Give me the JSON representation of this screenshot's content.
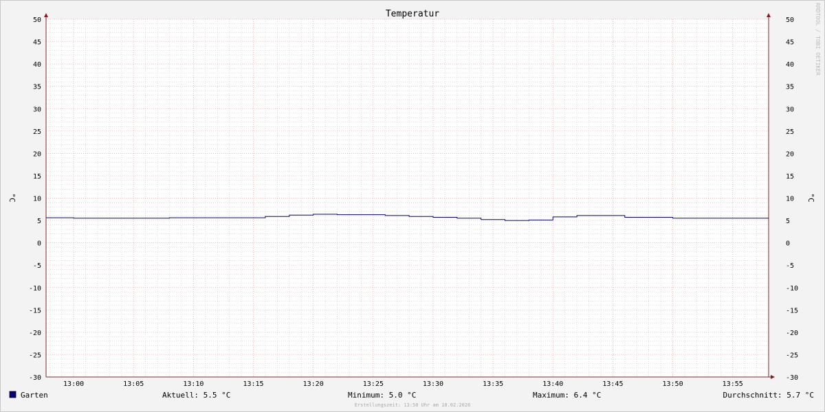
{
  "chart_data": {
    "type": "line",
    "title": "Temperatur",
    "ylabel": "°C",
    "ylim": [
      -30,
      50
    ],
    "yticks": [
      50,
      45,
      40,
      35,
      30,
      25,
      20,
      15,
      10,
      5,
      0,
      -5,
      -10,
      -15,
      -20,
      -25,
      -30
    ],
    "xticks": [
      "13:00",
      "13:05",
      "13:10",
      "13:15",
      "13:20",
      "13:25",
      "13:30",
      "13:35",
      "13:40",
      "13:45",
      "13:50",
      "13:55"
    ],
    "x_range_minutes": [
      -2.3,
      58.0
    ],
    "series": [
      {
        "name": "Garten",
        "color": "#000080",
        "step_points": [
          [
            -2.3,
            5.6
          ],
          [
            0,
            5.5
          ],
          [
            2,
            5.5
          ],
          [
            4,
            5.5
          ],
          [
            6,
            5.5
          ],
          [
            8,
            5.6
          ],
          [
            10,
            5.6
          ],
          [
            12,
            5.6
          ],
          [
            14,
            5.6
          ],
          [
            16,
            5.9
          ],
          [
            18,
            6.2
          ],
          [
            20,
            6.4
          ],
          [
            22,
            6.3
          ],
          [
            24,
            6.3
          ],
          [
            26,
            6.1
          ],
          [
            28,
            5.9
          ],
          [
            30,
            5.7
          ],
          [
            32,
            5.5
          ],
          [
            34,
            5.2
          ],
          [
            36,
            5.0
          ],
          [
            38,
            5.1
          ],
          [
            40,
            5.8
          ],
          [
            42,
            6.1
          ],
          [
            44,
            6.1
          ],
          [
            46,
            5.7
          ],
          [
            48,
            5.7
          ],
          [
            50,
            5.5
          ],
          [
            52,
            5.5
          ],
          [
            54,
            5.5
          ],
          [
            56,
            5.5
          ]
        ]
      }
    ],
    "grid": true,
    "legend_position": "bottom-left"
  },
  "legend": {
    "series_name": "Garten",
    "aktuell": "Aktuell: 5.5 °C",
    "minimum": "Minimum: 5.0 °C",
    "maximum": "Maximum: 6.4 °C",
    "durchschnitt": "Durchschnitt: 5.7 °C"
  },
  "footer": "Erstellungszeit: 13:58 Uhr am 18.02.2026",
  "watermark": "RRDTOOL / TOBI OETIKER",
  "colors": {
    "background": "#f3f3f3",
    "plot": "#ffffff",
    "major_grid": "#e8a0a0",
    "minor_grid": "#c8c8c8",
    "axis": "#7a2a2a",
    "series": "#000080"
  }
}
